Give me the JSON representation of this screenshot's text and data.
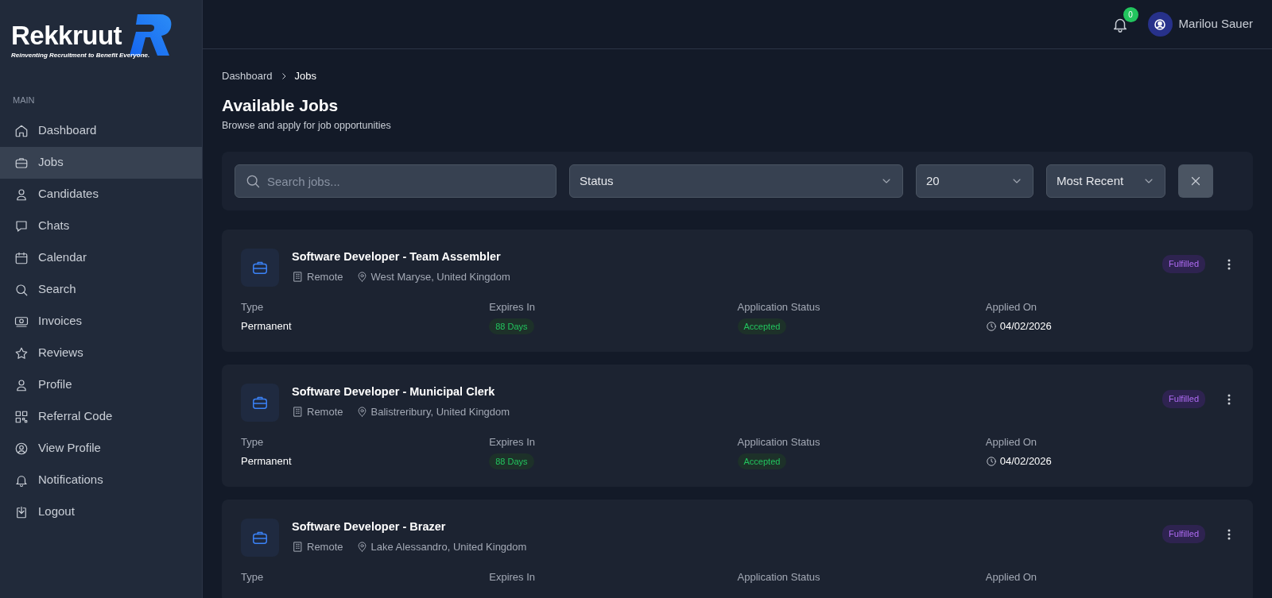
{
  "sidebar": {
    "logo": {
      "name": "Rekkruut",
      "tagline": "Reinventing Recruitment to Benefit Everyone."
    },
    "section_label": "MAIN",
    "items": [
      {
        "label": "Dashboard",
        "selected": false
      },
      {
        "label": "Jobs",
        "selected": true
      },
      {
        "label": "Candidates",
        "selected": false
      },
      {
        "label": "Chats",
        "selected": false
      },
      {
        "label": "Calendar",
        "selected": false
      },
      {
        "label": "Search",
        "selected": false
      },
      {
        "label": "Invoices",
        "selected": false
      },
      {
        "label": "Reviews",
        "selected": false
      },
      {
        "label": "Profile",
        "selected": false
      },
      {
        "label": "Referral Code",
        "selected": false
      },
      {
        "label": "View Profile",
        "selected": false
      },
      {
        "label": "Notifications",
        "selected": false
      },
      {
        "label": "Logout",
        "selected": false
      }
    ]
  },
  "header": {
    "notification_count": "0",
    "user_name": "Marilou Sauer"
  },
  "breadcrumb": [
    {
      "label": "Dashboard"
    },
    {
      "label": "Jobs"
    }
  ],
  "page": {
    "title": "Available Jobs",
    "subtitle": "Browse and apply for job opportunities"
  },
  "filters": {
    "search": {
      "placeholder": "Search jobs..."
    },
    "status": {
      "value": "Status"
    },
    "per_page": {
      "value": "20"
    },
    "sort": {
      "value": "Most Recent"
    }
  },
  "jobs": [
    {
      "title": "Software Developer - Team Assembler",
      "work_mode": "Remote",
      "location": "West Maryse, United Kingdom",
      "status": "Fulfilled",
      "fields": [
        {
          "label": "Type",
          "value": "Permanent",
          "kind": "text"
        },
        {
          "label": "Expires In",
          "value": "88 Days",
          "kind": "badge"
        },
        {
          "label": "Application Status",
          "value": "Accepted",
          "kind": "badge"
        },
        {
          "label": "Applied On",
          "value": "04/02/2026",
          "kind": "date"
        }
      ]
    },
    {
      "title": "Software Developer - Municipal Clerk",
      "work_mode": "Remote",
      "location": "Balistreribury, United Kingdom",
      "status": "Fulfilled",
      "fields": [
        {
          "label": "Type",
          "value": "Permanent",
          "kind": "text"
        },
        {
          "label": "Expires In",
          "value": "88 Days",
          "kind": "badge"
        },
        {
          "label": "Application Status",
          "value": "Accepted",
          "kind": "badge"
        },
        {
          "label": "Applied On",
          "value": "04/02/2026",
          "kind": "date"
        }
      ]
    },
    {
      "title": "Software Developer - Brazer",
      "work_mode": "Remote",
      "location": "Lake Alessandro, United Kingdom",
      "status": "Fulfilled",
      "fields": [
        {
          "label": "Type"
        },
        {
          "label": "Expires In"
        },
        {
          "label": "Application Status"
        },
        {
          "label": "Applied On"
        }
      ]
    }
  ]
}
